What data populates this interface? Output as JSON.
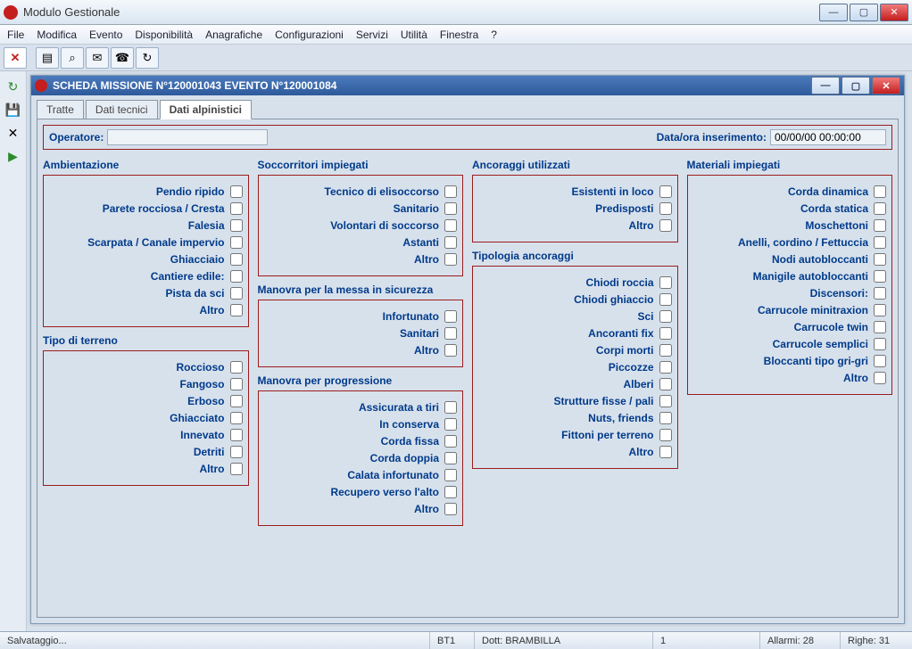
{
  "app": {
    "title": "Modulo Gestionale"
  },
  "menu": [
    "File",
    "Modifica",
    "Evento",
    "Disponibilità",
    "Anagrafiche",
    "Configurazioni",
    "Servizi",
    "Utilità",
    "Finestra",
    "?"
  ],
  "doc": {
    "title": "SCHEDA MISSIONE N°120001043  EVENTO N°120001084"
  },
  "tabs": [
    {
      "label": "Tratte",
      "active": false
    },
    {
      "label": "Dati tecnici",
      "active": false
    },
    {
      "label": "Dati alpinistici",
      "active": true
    }
  ],
  "header": {
    "operatore_label": "Operatore:",
    "operatore_value": "",
    "data_label": "Data/ora inserimento:",
    "data_value": "00/00/00 00:00:00"
  },
  "groups": {
    "col1": [
      {
        "legend": "Ambientazione",
        "items": [
          "Pendio ripido",
          "Parete rocciosa / Cresta",
          "Falesia",
          "Scarpata / Canale impervio",
          "Ghiacciaio",
          "Cantiere edile:",
          "Pista da sci",
          "Altro"
        ]
      },
      {
        "legend": "Tipo di terreno",
        "items": [
          "Roccioso",
          "Fangoso",
          "Erboso",
          "Ghiacciato",
          "Innevato",
          "Detriti",
          "Altro"
        ]
      }
    ],
    "col2": [
      {
        "legend": "Soccorritori impiegati",
        "items": [
          "Tecnico di elisoccorso",
          "Sanitario",
          "Volontari di soccorso",
          "Astanti",
          "Altro"
        ]
      },
      {
        "legend": "Manovra per la messa in sicurezza",
        "items": [
          "Infortunato",
          "Sanitari",
          "Altro"
        ]
      },
      {
        "legend": "Manovra per progressione",
        "items": [
          "Assicurata a tiri",
          "In conserva",
          "Corda fissa",
          "Corda doppia",
          "Calata infortunato",
          "Recupero verso l'alto",
          "Altro"
        ]
      }
    ],
    "col3": [
      {
        "legend": "Ancoraggi utilizzati",
        "items": [
          "Esistenti in loco",
          "Predisposti",
          "Altro"
        ]
      },
      {
        "legend": "Tipologia ancoraggi",
        "items": [
          "Chiodi roccia",
          "Chiodi ghiaccio",
          "Sci",
          "Ancoranti fix",
          "Corpi morti",
          "Piccozze",
          "Alberi",
          "Strutture fisse / pali",
          "Nuts, friends",
          "Fittoni per terreno",
          "Altro"
        ]
      }
    ],
    "col4": [
      {
        "legend": "Materiali impiegati",
        "items": [
          "Corda dinamica",
          "Corda statica",
          "Moschettoni",
          "Anelli, cordino / Fettuccia",
          "Nodi autobloccanti",
          "Manigile autobloccanti",
          "Discensori:",
          "Carrucole minitraxion",
          "Carrucole twin",
          "Carrucole semplici",
          "Bloccanti tipo gri-gri",
          "Altro"
        ]
      }
    ]
  },
  "status": {
    "left": "Salvataggio...",
    "bt": "BT1",
    "dott": "Dott: BRAMBILLA",
    "num": "1",
    "allarmi": "Allarmi: 28",
    "righe": "Righe: 31"
  }
}
